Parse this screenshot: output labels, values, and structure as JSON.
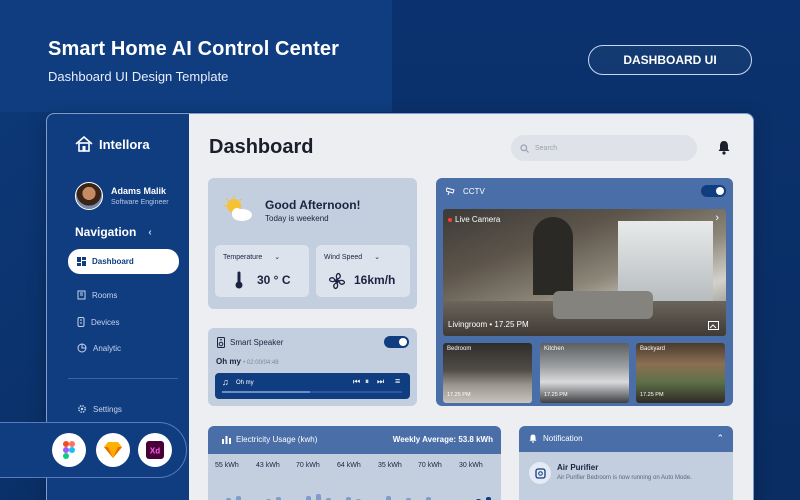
{
  "promo": {
    "title": "Smart Home AI Control Center",
    "subtitle": "Dashboard UI Design Template",
    "badge": "DASHBOARD UI"
  },
  "sidebar": {
    "brand": "Intellora",
    "user": {
      "name": "Adams Malik",
      "role": "Software Engineer"
    },
    "nav_title": "Navigation",
    "items": [
      {
        "label": "Dashboard",
        "icon": "grid-icon",
        "active": true
      },
      {
        "label": "Rooms",
        "icon": "building-icon"
      },
      {
        "label": "Devices",
        "icon": "device-icon"
      },
      {
        "label": "Analytic",
        "icon": "analytic-icon"
      }
    ],
    "settings": "Settings"
  },
  "main": {
    "title": "Dashboard",
    "search_placeholder": "Search"
  },
  "greeting": {
    "title": "Good Afternoon!",
    "subtitle": "Today is weekend",
    "temperature_label": "Temperature",
    "temperature_value": "30 ° C",
    "wind_label": "Wind Speed",
    "wind_value": "16km/h"
  },
  "speaker": {
    "title": "Smart Speaker",
    "song": "Oh my",
    "time": "• 02:00/04:48",
    "player_label": "Oh my",
    "progress": 0.47,
    "enabled": true
  },
  "cctv": {
    "title": "CCTV",
    "enabled": true,
    "main_label": "Live Camera",
    "main_room": "Livingroom • 17.25 PM",
    "thumbs": [
      {
        "label": "Bedroom",
        "time": "17.25 PM"
      },
      {
        "label": "Kitchen",
        "time": "17.25 PM"
      },
      {
        "label": "Backyard",
        "time": "17.25 PM"
      }
    ]
  },
  "electricity": {
    "title": "Electricity Usage (kwh)",
    "average": "Weekly Average: 53.8 kWh",
    "values": [
      "55 kWh",
      "43 kWh",
      "70 kWh",
      "64 kWh",
      "35 kWh",
      "70 kWh",
      "30 kWh"
    ]
  },
  "notification": {
    "title": "Notification",
    "item_title": "Air Purifier",
    "item_text": "Air Purifier Bedroom is now running on Auto Mode."
  },
  "colors": {
    "primary": "#0f3d80",
    "panel_header": "#4a6ea8",
    "card_bg": "#c3cede"
  },
  "tools": [
    "figma-icon",
    "sketch-icon",
    "xd-icon"
  ]
}
